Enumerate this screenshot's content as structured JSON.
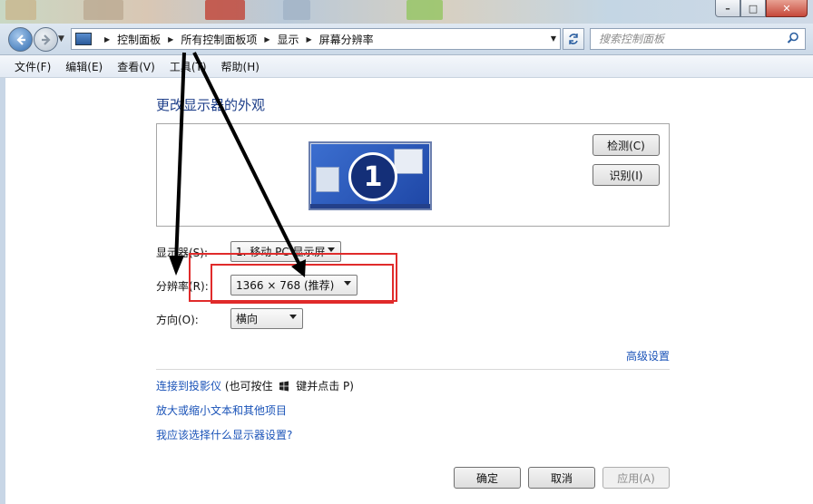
{
  "window": {
    "controls": {
      "minimize": "–",
      "maximize": "□",
      "close": "✕"
    }
  },
  "address_bar": {
    "breadcrumbs": [
      "控制面板",
      "所有控制面板项",
      "显示",
      "屏幕分辨率"
    ],
    "search_placeholder": "搜索控制面板"
  },
  "menu": {
    "items": [
      "文件(F)",
      "编辑(E)",
      "查看(V)",
      "工具(T)",
      "帮助(H)"
    ]
  },
  "main": {
    "heading": "更改显示器的外观",
    "monitor_number": "1",
    "detect_button": "检测(C)",
    "identify_button": "识别(I)",
    "display_label": "显示器(S):",
    "display_value": "1. 移动 PC 显示屏",
    "resolution_label": "分辨率(R):",
    "resolution_value": "1366 × 768 (推荐)",
    "orientation_label": "方向(O):",
    "orientation_value": "横向",
    "advanced_link": "高级设置",
    "projector_link": "连接到投影仪",
    "projector_hint_prefix": "(也可按住",
    "projector_hint_suffix": "键并点击 P)",
    "text_size_link": "放大或缩小文本和其他项目",
    "help_link": "我应该选择什么显示器设置?"
  },
  "footer": {
    "ok": "确定",
    "cancel": "取消",
    "apply": "应用(A)"
  },
  "colors": {
    "link": "#1a53b8",
    "heading": "#1e3f8a",
    "annotation_red": "#e02b2b"
  }
}
